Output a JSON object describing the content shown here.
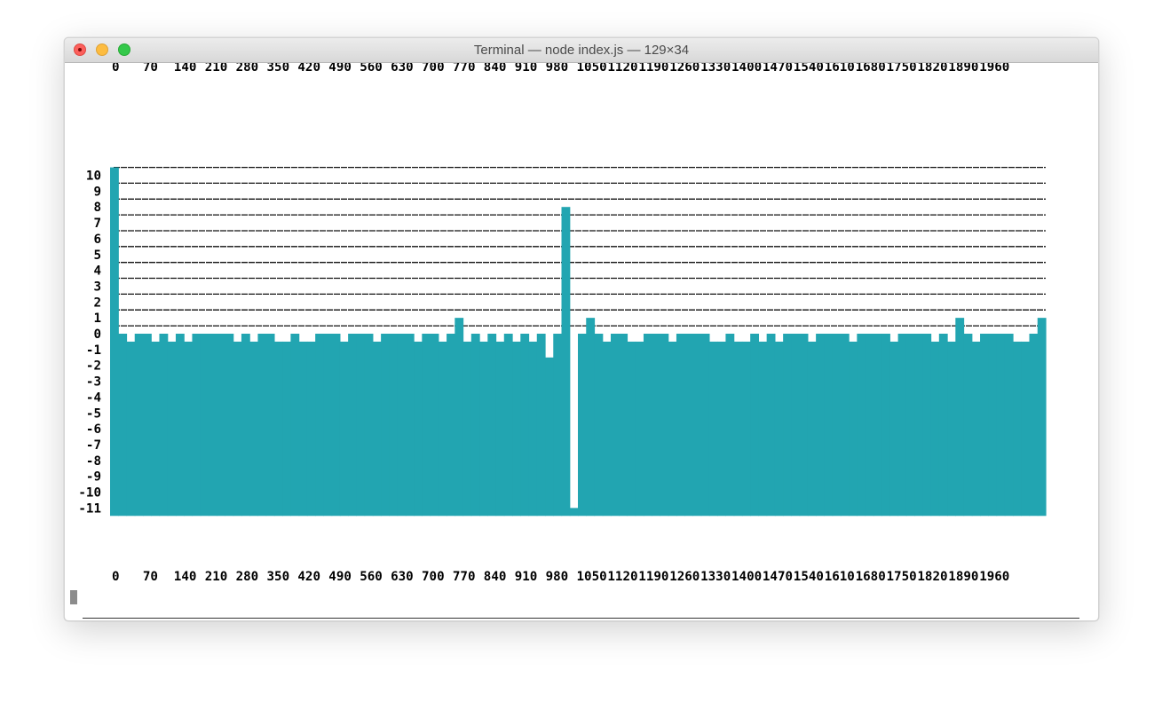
{
  "window": {
    "title": "Terminal — node index.js — 129×34",
    "colors": {
      "bar": "#22a5b1",
      "rule": "#111111",
      "text": "#000000"
    }
  },
  "chart_data": {
    "type": "bar",
    "title": "",
    "xlabel": "",
    "ylabel": "",
    "ylim": [
      -11.5,
      10.5
    ],
    "grid": true,
    "x_tick_labels": [
      "0",
      "70",
      "140",
      "210",
      "280",
      "350",
      "420",
      "490",
      "560",
      "630",
      "700",
      "770",
      "840",
      "910",
      "980",
      "1050",
      "1120",
      "1190",
      "1260",
      "1330",
      "1400",
      "1470",
      "1540",
      "1610",
      "1680",
      "1750",
      "1820",
      "1890",
      "1960"
    ],
    "y_tick_labels": [
      "10",
      "9",
      "8",
      "7",
      "6",
      "5",
      "4",
      "3",
      "2",
      "1",
      "0",
      "-1",
      "-2",
      "-3",
      "-4",
      "-5",
      "-6",
      "-7",
      "-8",
      "-9",
      "-10",
      "-11"
    ],
    "y_tick_values": [
      10,
      9,
      8,
      7,
      6,
      5,
      4,
      3,
      2,
      1,
      0,
      -1,
      -2,
      -3,
      -4,
      -5,
      -6,
      -7,
      -8,
      -9,
      -10,
      -11
    ],
    "series": [
      {
        "values": [
          10.5,
          0,
          -0.5,
          0,
          0,
          -0.5,
          0,
          -0.5,
          0,
          -0.5,
          0,
          0,
          0,
          0,
          0,
          -0.5,
          0,
          -0.5,
          0,
          0,
          -0.5,
          -0.5,
          0,
          -0.5,
          -0.5,
          0,
          0,
          0,
          -0.5,
          0,
          0,
          0,
          -0.5,
          0,
          0,
          0,
          0,
          -0.5,
          0,
          0,
          -0.5,
          0,
          1,
          -0.5,
          0,
          -0.5,
          0,
          -0.5,
          0,
          -0.5,
          0,
          -0.5,
          0,
          -1.5,
          0,
          8,
          -11,
          0,
          1,
          0,
          -0.5,
          0,
          0,
          -0.5,
          -0.5,
          0,
          0,
          0,
          -0.5,
          0,
          0,
          0,
          0,
          -0.5,
          -0.5,
          0,
          -0.5,
          -0.5,
          0,
          -0.5,
          0,
          -0.5,
          0,
          0,
          0,
          -0.5,
          0,
          0,
          0,
          0,
          -0.5,
          0,
          0,
          0,
          0,
          -0.5,
          0,
          0,
          0,
          0,
          -0.5,
          0,
          -0.5,
          1,
          0,
          -0.5,
          0,
          0,
          0,
          0,
          -0.5,
          -0.5,
          0,
          1
        ]
      }
    ]
  }
}
